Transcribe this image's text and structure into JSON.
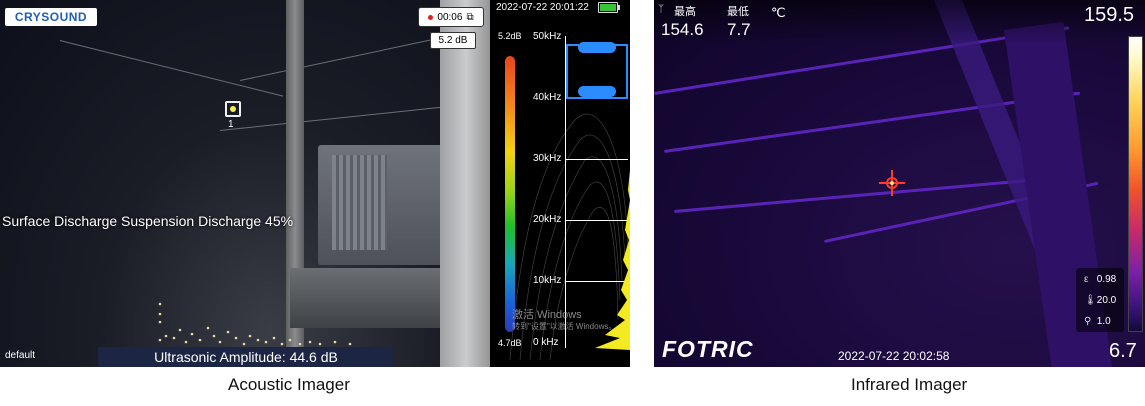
{
  "acoustic_panel": {
    "brand_logo": "CRYSOUND",
    "record_time": "00:06",
    "level_box": "5.2 dB",
    "datetime": "2022-07-22 20:01:22",
    "target_number": "1",
    "diagnosis_text": "Surface Discharge Suspension Discharge 45%",
    "profile": "default",
    "amplitude_text": "Ultrasonic Amplitude: 44.6 dB",
    "colorbar": {
      "max": "5.2dB",
      "min": "4.7dB"
    },
    "frequency_axis": [
      "50kHz",
      "40kHz",
      "30kHz",
      "20kHz",
      "10kHz",
      "0  kHz"
    ],
    "watermark_line1": "激活 Windows",
    "watermark_line2": "转到\"设置\"以激活 Windows。",
    "caption": "Acoustic Imager"
  },
  "infrared_panel": {
    "label_max": "最高",
    "label_min": "最低",
    "value_max": "154.6",
    "value_min": "7.7",
    "unit": "℃",
    "scale_max": "159.5",
    "scale_min": "6.7",
    "params": [
      {
        "icon": "ε",
        "value": "0.98"
      },
      {
        "icon": "🌡",
        "value": "20.0"
      },
      {
        "icon": "⚲",
        "value": "1.0"
      }
    ],
    "brand_logo": "FOTRIC",
    "datetime": "2022-07-22 20:02:58",
    "caption": "Infrared Imager"
  }
}
